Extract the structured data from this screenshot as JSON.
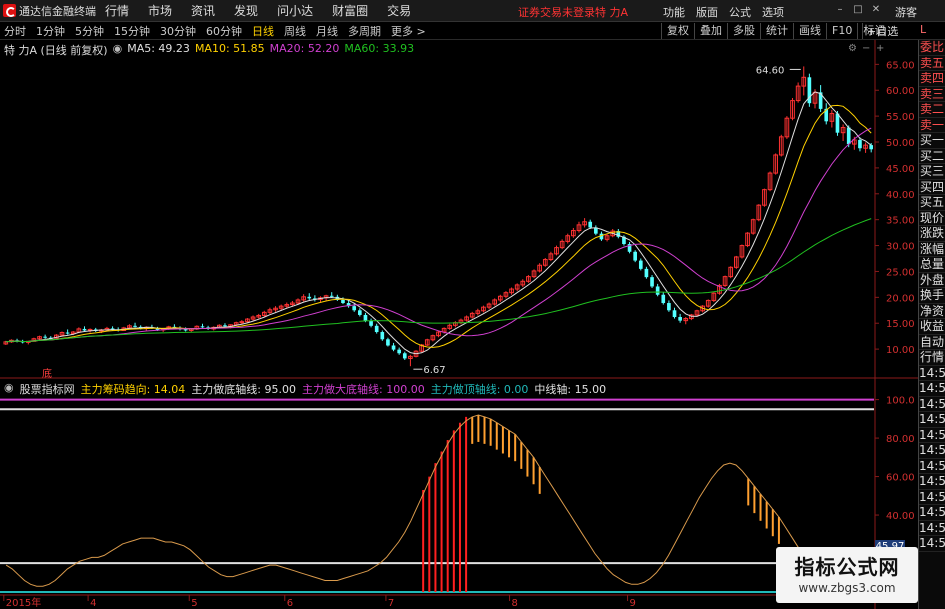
{
  "menubar": {
    "app_title": "通达信金融终端",
    "items": [
      "行情",
      "市场",
      "资讯",
      "发现",
      "问小达",
      "财富圈",
      "交易"
    ],
    "login_status": "证券交易未登录",
    "stock_name": "特 力A",
    "right_items": [
      "功能",
      "版面",
      "公式",
      "选项"
    ],
    "guest": "游客"
  },
  "periodbar": {
    "items": [
      "分时",
      "1分钟",
      "5分钟",
      "15分钟",
      "30分钟",
      "60分钟",
      "日线",
      "周线",
      "月线",
      "多周期",
      "更多 >"
    ],
    "active": "日线",
    "tools": [
      "复权",
      "叠加",
      "多股",
      "统计",
      "画线",
      "F10",
      "标记"
    ],
    "zixuan": "+自选",
    "L": "L"
  },
  "legend_main": {
    "name": "特 力A (日线 前复权)",
    "items": [
      {
        "label": "MA5: 49.23",
        "color": "#e0e0e0"
      },
      {
        "label": "MA10: 51.85",
        "color": "#ffd100"
      },
      {
        "label": "MA20: 52.20",
        "color": "#d040d0"
      },
      {
        "label": "MA60: 33.93",
        "color": "#20c020"
      }
    ]
  },
  "legend_sub": {
    "name": "股票指标网",
    "items": [
      {
        "label": "主力筹码趋向: 14.04",
        "color": "#ffd100"
      },
      {
        "label": "主力做底轴线: 95.00",
        "color": "#e0e0e0"
      },
      {
        "label": "主力做大底轴线: 100.00",
        "color": "#d040d0"
      },
      {
        "label": "主力做顶轴线: 0.00",
        "color": "#20b8b8"
      },
      {
        "label": "中线轴: 15.00",
        "color": "#e0e0e0"
      }
    ]
  },
  "annotations": {
    "high": "64.60",
    "low": "6.67",
    "ding": "底"
  },
  "main_axis_labels": [
    "65.00",
    "60.00",
    "55.00",
    "50.00",
    "45.00",
    "40.00",
    "35.00",
    "30.00",
    "25.00",
    "20.00",
    "15.00",
    "10.00"
  ],
  "sub_axis_labels": [
    "100.0",
    "80.00",
    "60.00",
    "40.00",
    "20.00"
  ],
  "sub_value_box": "45.97",
  "x_labels": [
    "2015年",
    "4",
    "5",
    "6",
    "7",
    "8",
    "9"
  ],
  "sidebar": {
    "items": [
      "委比",
      "卖五",
      "卖四",
      "卖三",
      "卖二",
      "卖一",
      "买一",
      "买二",
      "买三",
      "买四",
      "买五",
      "现价",
      "涨跌",
      "涨幅",
      "总量",
      "外盘",
      "换手",
      "净资",
      "收益",
      "自动",
      "行情",
      "14:5",
      "14:5",
      "14:5",
      "14:5",
      "14:5",
      "14:5",
      "14:5",
      "14:5",
      "14:5",
      "14:5",
      "14:5",
      "14:5"
    ]
  },
  "watermark": {
    "title": "指标公式网",
    "url": "www.zbgs3.com"
  },
  "chart_data": [
    {
      "type": "candlestick",
      "title": "特 力A (日线 前复权)",
      "ylim": [
        5,
        67
      ],
      "y_ticks": [
        10,
        15,
        20,
        25,
        30,
        35,
        40,
        45,
        50,
        55,
        60,
        65
      ],
      "x_ticks": [
        "2015年",
        "4",
        "5",
        "6",
        "7",
        "8",
        "9"
      ],
      "ohlc": [
        [
          11.0,
          11.6,
          10.8,
          11.4
        ],
        [
          11.4,
          11.9,
          11.2,
          11.7
        ],
        [
          11.7,
          12.0,
          11.3,
          11.5
        ],
        [
          11.5,
          11.8,
          11.1,
          11.3
        ],
        [
          11.3,
          11.6,
          10.9,
          11.5
        ],
        [
          11.5,
          12.2,
          11.4,
          12.0
        ],
        [
          12.0,
          12.6,
          11.8,
          12.4
        ],
        [
          12.4,
          12.8,
          12.0,
          12.2
        ],
        [
          12.2,
          12.5,
          11.9,
          12.1
        ],
        [
          12.1,
          12.9,
          12.0,
          12.7
        ],
        [
          12.7,
          13.4,
          12.5,
          13.2
        ],
        [
          13.2,
          13.8,
          12.8,
          13.0
        ],
        [
          13.0,
          13.5,
          12.7,
          13.3
        ],
        [
          13.3,
          14.2,
          13.1,
          13.9
        ],
        [
          13.9,
          14.4,
          13.5,
          13.6
        ],
        [
          13.6,
          14.0,
          13.2,
          13.8
        ],
        [
          13.8,
          14.1,
          13.3,
          13.5
        ],
        [
          13.5,
          13.9,
          13.1,
          13.7
        ],
        [
          13.7,
          14.3,
          13.5,
          14.0
        ],
        [
          14.0,
          14.4,
          13.6,
          13.8
        ],
        [
          13.8,
          14.2,
          13.4,
          13.6
        ],
        [
          13.6,
          14.3,
          13.5,
          14.1
        ],
        [
          14.1,
          14.8,
          13.9,
          14.5
        ],
        [
          14.5,
          15.1,
          14.2,
          14.3
        ],
        [
          14.3,
          14.6,
          13.8,
          14.0
        ],
        [
          14.0,
          14.4,
          13.6,
          14.2
        ],
        [
          14.2,
          14.7,
          13.9,
          14.0
        ],
        [
          14.0,
          14.3,
          13.5,
          13.7
        ],
        [
          13.7,
          14.1,
          13.3,
          13.9
        ],
        [
          13.9,
          14.5,
          13.7,
          14.3
        ],
        [
          14.3,
          14.8,
          14.0,
          14.1
        ],
        [
          14.1,
          14.4,
          13.6,
          13.8
        ],
        [
          13.8,
          14.2,
          13.4,
          13.6
        ],
        [
          13.6,
          14.0,
          13.2,
          13.9
        ],
        [
          13.9,
          14.6,
          13.7,
          14.4
        ],
        [
          14.4,
          14.9,
          14.1,
          14.2
        ],
        [
          14.2,
          14.5,
          13.7,
          13.9
        ],
        [
          13.9,
          14.4,
          13.6,
          14.2
        ],
        [
          14.2,
          14.8,
          14.0,
          14.6
        ],
        [
          14.6,
          15.0,
          14.2,
          14.4
        ],
        [
          14.4,
          14.8,
          14.0,
          14.7
        ],
        [
          14.7,
          15.3,
          14.5,
          15.1
        ],
        [
          15.1,
          15.6,
          14.8,
          15.3
        ],
        [
          15.3,
          16.0,
          15.1,
          15.8
        ],
        [
          15.8,
          16.5,
          15.5,
          16.2
        ],
        [
          16.2,
          16.8,
          15.9,
          16.5
        ],
        [
          16.5,
          17.4,
          16.3,
          17.1
        ],
        [
          17.1,
          18.0,
          16.8,
          17.6
        ],
        [
          17.6,
          18.3,
          17.2,
          17.9
        ],
        [
          17.9,
          18.6,
          17.4,
          18.3
        ],
        [
          18.3,
          19.0,
          17.9,
          18.6
        ],
        [
          18.6,
          19.3,
          18.2,
          18.9
        ],
        [
          18.9,
          19.8,
          18.6,
          19.5
        ],
        [
          19.5,
          20.6,
          19.2,
          20.1
        ],
        [
          20.1,
          20.8,
          19.5,
          19.8
        ],
        [
          19.8,
          20.4,
          19.2,
          19.6
        ],
        [
          19.6,
          20.2,
          19.1,
          19.9
        ],
        [
          19.9,
          20.5,
          19.4,
          20.3
        ],
        [
          20.3,
          21.0,
          19.9,
          20.1
        ],
        [
          20.1,
          20.5,
          19.3,
          19.5
        ],
        [
          19.5,
          20.0,
          18.7,
          18.9
        ],
        [
          18.9,
          19.4,
          18.0,
          18.3
        ],
        [
          18.3,
          18.8,
          17.2,
          17.5
        ],
        [
          17.5,
          17.9,
          16.3,
          16.6
        ],
        [
          16.6,
          17.0,
          15.2,
          15.5
        ],
        [
          15.5,
          15.9,
          14.2,
          14.5
        ],
        [
          14.5,
          14.9,
          13.0,
          13.3
        ],
        [
          13.3,
          13.6,
          11.6,
          11.9
        ],
        [
          11.9,
          12.2,
          10.5,
          10.7
        ],
        [
          10.7,
          11.2,
          9.6,
          9.9
        ],
        [
          9.9,
          10.3,
          8.9,
          9.2
        ],
        [
          9.2,
          9.5,
          7.9,
          8.2
        ],
        [
          8.2,
          8.9,
          6.7,
          8.6
        ],
        [
          8.6,
          9.8,
          8.4,
          9.6
        ],
        [
          9.6,
          11.0,
          9.4,
          10.8
        ],
        [
          10.8,
          12.0,
          10.6,
          11.8
        ],
        [
          11.8,
          12.8,
          11.5,
          12.6
        ],
        [
          12.6,
          13.6,
          12.3,
          13.3
        ],
        [
          13.3,
          14.2,
          13.0,
          14.0
        ],
        [
          14.0,
          14.9,
          13.7,
          14.6
        ],
        [
          14.6,
          15.4,
          14.2,
          15.1
        ],
        [
          15.1,
          15.9,
          14.8,
          15.6
        ],
        [
          15.6,
          16.5,
          15.3,
          16.2
        ],
        [
          16.2,
          17.2,
          15.9,
          16.9
        ],
        [
          16.9,
          17.8,
          16.5,
          17.4
        ],
        [
          17.4,
          18.4,
          17.1,
          18.1
        ],
        [
          18.1,
          19.0,
          17.7,
          18.7
        ],
        [
          18.7,
          19.8,
          18.4,
          19.5
        ],
        [
          19.5,
          20.5,
          19.1,
          20.2
        ],
        [
          20.2,
          21.2,
          19.8,
          20.9
        ],
        [
          20.9,
          21.9,
          20.5,
          21.6
        ],
        [
          21.6,
          22.7,
          21.2,
          22.4
        ],
        [
          22.4,
          23.5,
          22.0,
          23.1
        ],
        [
          23.1,
          24.3,
          22.8,
          24.0
        ],
        [
          24.0,
          25.4,
          23.7,
          25.1
        ],
        [
          25.1,
          26.6,
          24.8,
          26.2
        ],
        [
          26.2,
          27.6,
          25.9,
          27.3
        ],
        [
          27.3,
          28.8,
          27.0,
          28.4
        ],
        [
          28.4,
          30.0,
          28.1,
          29.6
        ],
        [
          29.6,
          31.2,
          29.3,
          30.8
        ],
        [
          30.8,
          32.3,
          30.4,
          31.9
        ],
        [
          31.9,
          33.4,
          31.5,
          32.9
        ],
        [
          32.9,
          34.6,
          32.5,
          34.0
        ],
        [
          34.0,
          35.3,
          33.5,
          34.6
        ],
        [
          34.6,
          35.0,
          33.2,
          33.5
        ],
        [
          33.5,
          33.9,
          32.0,
          32.3
        ],
        [
          32.3,
          32.7,
          30.9,
          31.2
        ],
        [
          31.2,
          32.3,
          30.8,
          31.9
        ],
        [
          31.9,
          33.2,
          31.6,
          32.8
        ],
        [
          32.8,
          33.2,
          31.4,
          31.7
        ],
        [
          31.7,
          32.0,
          30.0,
          30.3
        ],
        [
          30.3,
          30.7,
          28.5,
          28.8
        ],
        [
          28.8,
          29.1,
          26.8,
          27.1
        ],
        [
          27.1,
          27.5,
          25.2,
          25.5
        ],
        [
          25.5,
          25.9,
          23.6,
          23.9
        ],
        [
          23.9,
          24.3,
          21.8,
          22.1
        ],
        [
          22.1,
          22.6,
          20.2,
          20.5
        ],
        [
          20.5,
          21.0,
          18.6,
          18.9
        ],
        [
          18.9,
          19.4,
          17.2,
          17.5
        ],
        [
          17.5,
          18.0,
          15.9,
          16.2
        ],
        [
          16.2,
          16.8,
          15.1,
          15.5
        ],
        [
          15.5,
          16.2,
          14.8,
          15.9
        ],
        [
          15.9,
          16.8,
          15.6,
          16.6
        ],
        [
          16.6,
          17.6,
          16.3,
          17.4
        ],
        [
          17.4,
          18.5,
          17.1,
          18.3
        ],
        [
          18.3,
          19.6,
          18.0,
          19.4
        ],
        [
          19.4,
          21.0,
          19.1,
          20.8
        ],
        [
          20.8,
          22.6,
          20.5,
          22.3
        ],
        [
          22.3,
          24.2,
          22.0,
          24.0
        ],
        [
          24.0,
          26.0,
          23.7,
          25.8
        ],
        [
          25.8,
          28.0,
          25.5,
          27.8
        ],
        [
          27.8,
          30.2,
          27.5,
          30.0
        ],
        [
          30.0,
          32.6,
          29.7,
          32.4
        ],
        [
          32.4,
          35.2,
          32.1,
          35.0
        ],
        [
          35.0,
          38.0,
          34.7,
          37.8
        ],
        [
          37.8,
          41.0,
          37.5,
          40.8
        ],
        [
          40.8,
          44.3,
          40.5,
          44.0
        ],
        [
          44.0,
          47.8,
          43.7,
          47.5
        ],
        [
          47.5,
          51.4,
          47.2,
          51.0
        ],
        [
          51.0,
          55.0,
          50.6,
          54.6
        ],
        [
          54.6,
          58.5,
          54.2,
          58.0
        ],
        [
          58.0,
          61.5,
          57.6,
          60.8
        ],
        [
          60.8,
          64.6,
          59.0,
          62.5
        ],
        [
          62.5,
          63.2,
          56.8,
          57.5
        ],
        [
          57.5,
          60.2,
          56.5,
          59.6
        ],
        [
          59.6,
          61.0,
          55.8,
          56.4
        ],
        [
          56.4,
          57.5,
          53.4,
          54.0
        ],
        [
          54.0,
          56.2,
          52.8,
          55.5
        ],
        [
          55.5,
          56.0,
          51.2,
          51.8
        ],
        [
          51.8,
          53.4,
          50.2,
          52.8
        ],
        [
          52.8,
          53.2,
          49.0,
          49.6
        ],
        [
          49.6,
          51.0,
          48.5,
          50.4
        ],
        [
          50.4,
          50.9,
          48.2,
          48.8
        ],
        [
          48.8,
          49.9,
          47.9,
          49.4
        ],
        [
          49.4,
          49.8,
          48.0,
          48.6
        ]
      ],
      "ma5_last": 49.23,
      "ma10_last": 51.85,
      "ma20_last": 52.2,
      "ma60_last": 33.93,
      "annotations": [
        {
          "text": "64.60",
          "kind": "high"
        },
        {
          "text": "6.67",
          "kind": "low"
        }
      ]
    },
    {
      "type": "line",
      "title": "股票指标网",
      "ylim": [
        0,
        105
      ],
      "y_ticks": [
        20,
        40,
        60,
        80,
        100
      ],
      "series": [
        {
          "name": "主力筹码趋向",
          "color": "#d99a4c",
          "values": [
            14,
            12,
            9,
            6,
            4,
            3,
            3,
            4,
            6,
            9,
            12,
            14,
            16,
            17,
            18,
            18,
            19,
            21,
            23,
            25,
            26,
            27,
            28,
            28,
            28,
            27,
            26,
            26,
            25,
            24,
            22,
            19,
            16,
            13,
            11,
            9,
            8,
            8,
            9,
            10,
            11,
            12,
            13,
            14,
            14,
            13,
            12,
            11,
            10,
            9,
            8,
            7,
            6,
            6,
            6,
            7,
            8,
            9,
            10,
            11,
            13,
            15,
            18,
            22,
            26,
            31,
            37,
            44,
            51,
            58,
            65,
            71,
            77,
            82,
            86,
            89,
            91,
            92,
            91,
            90,
            88,
            86,
            84,
            82,
            78,
            74,
            70,
            65,
            60,
            55,
            50,
            45,
            40,
            35,
            30,
            25,
            20,
            16,
            12,
            9,
            7,
            5,
            4,
            4,
            5,
            7,
            10,
            14,
            19,
            25,
            31,
            37,
            43,
            49,
            54,
            59,
            63,
            66,
            67,
            66,
            63,
            59,
            55,
            51,
            47,
            43,
            39,
            34,
            29,
            24,
            19,
            15,
            11,
            8,
            6,
            5,
            5,
            6,
            8,
            10,
            12,
            14
          ]
        },
        {
          "name": "主力做底轴线",
          "color": "#e0e0e0",
          "constant": 95.0
        },
        {
          "name": "主力做大底轴线",
          "color": "#d040d0",
          "constant": 100.0
        },
        {
          "name": "主力做顶轴线",
          "color": "#20b8b8",
          "constant": 0.0
        },
        {
          "name": "中线轴",
          "color": "#e0e0e0",
          "constant": 15.0
        }
      ],
      "red_bar_ranges": [
        [
          68,
          76
        ]
      ],
      "orange_bar_ranges": [
        [
          76,
          88
        ],
        [
          121,
          127
        ]
      ]
    }
  ]
}
